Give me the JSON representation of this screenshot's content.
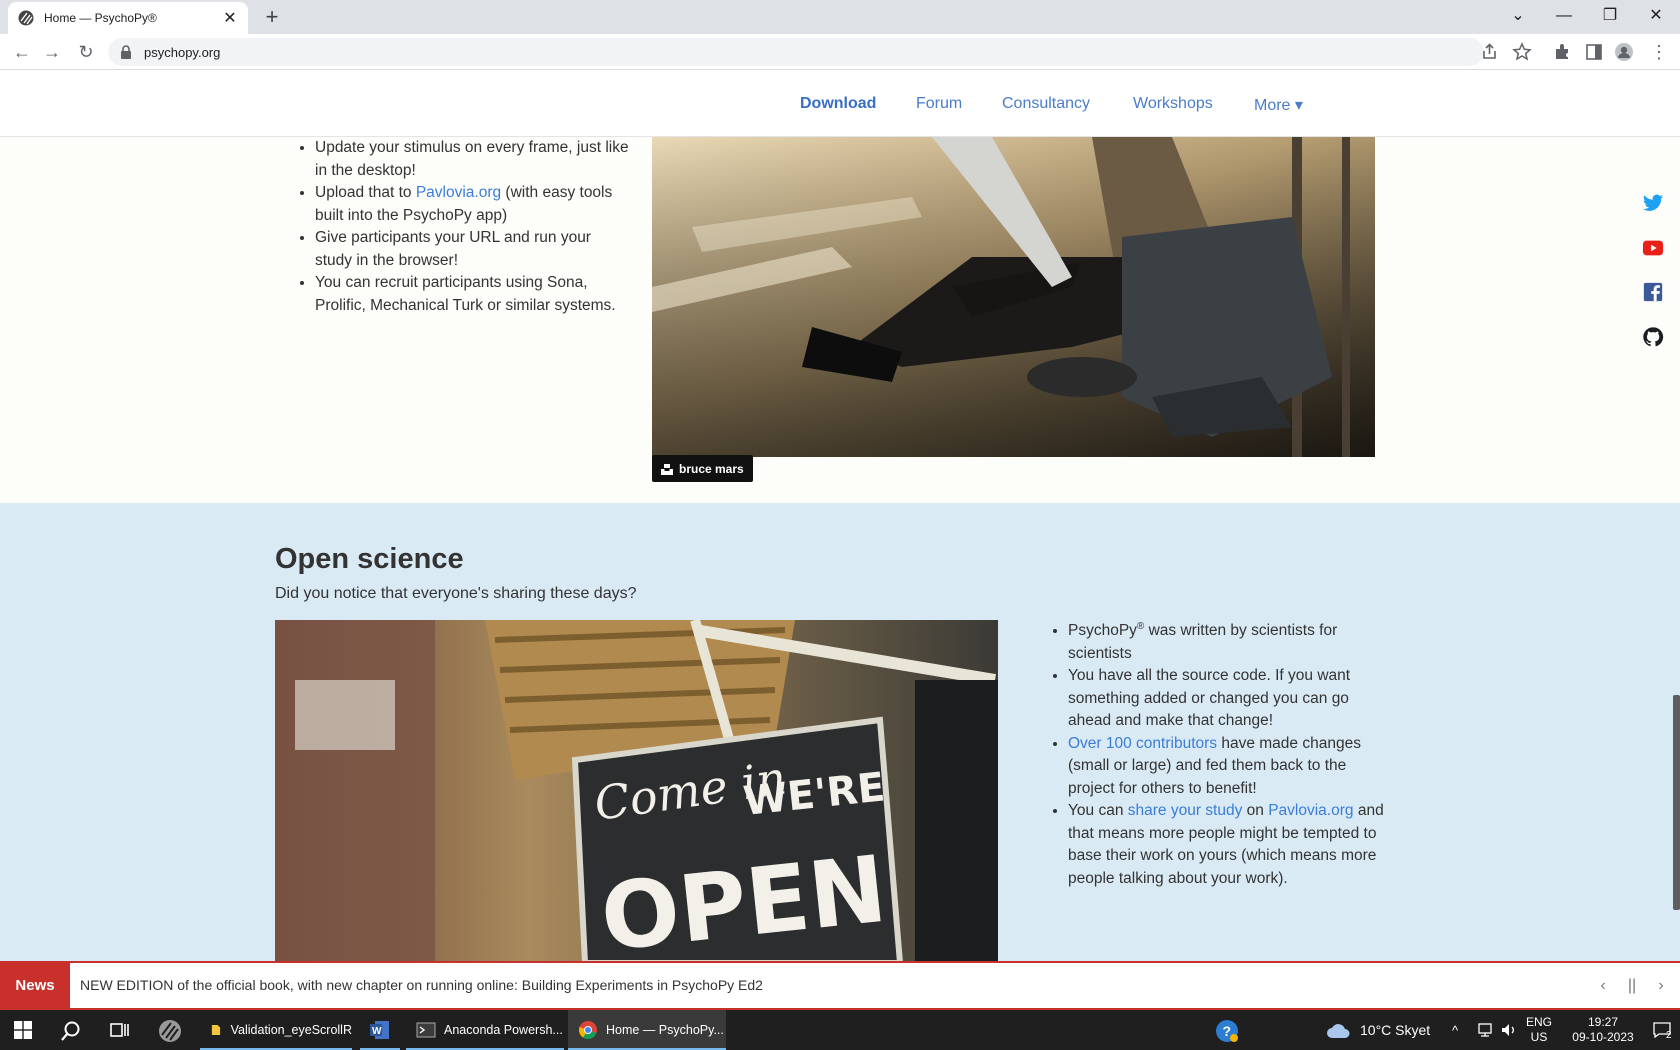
{
  "browser": {
    "tab_title": "Home — PsychoPy®",
    "url": "psychopy.org"
  },
  "nav": {
    "items": [
      {
        "label": "Download"
      },
      {
        "label": "Forum"
      },
      {
        "label": "Consultancy"
      },
      {
        "label": "Workshops"
      },
      {
        "label": "More ▾"
      }
    ]
  },
  "online_section": {
    "b1": "Update your stimulus on every frame, just like in the desktop!",
    "b2_pre": "Upload that to ",
    "b2_link": "Pavlovia.org",
    "b2_post": " (with easy tools built into the PsychoPy app)",
    "b3": "Give participants your URL and run your study in the browser!",
    "b4": "You can recruit participants using Sona, Prolific, Mechanical Turk or similar systems.",
    "photo_credit": "bruce mars"
  },
  "open_science": {
    "heading": "Open science",
    "subtitle": "Did you notice that everyone's sharing these days?",
    "b1_pre": "PsychoPy",
    "b1_sup": "®",
    "b1_post": " was written by scientists for scientists",
    "b2": "You have all the source code. If you want something added or changed you can go ahead and make that change!",
    "b3_link": "Over 100 contributors",
    "b3_post": " have made changes (small or large) and fed them back to the project for others to benefit!",
    "b4_pre": "You can ",
    "b4_link1": "share your study",
    "b4_mid": " on ",
    "b4_link2": "Pavlovia.org",
    "b4_post": " and that means more people might be tempted to base their work on yours (which means more people talking about your work).",
    "sign_text_1": "Come in",
    "sign_text_2": "WE'RE",
    "sign_text_3": "OPEN"
  },
  "news": {
    "label": "News",
    "text": "NEW EDITION of the official book, with new chapter on running online: Building Experiments in PsychoPy Ed2"
  },
  "taskbar": {
    "items": [
      {
        "label": "Validation_eyeScrollR"
      },
      {
        "label": "Anaconda Powersh..."
      },
      {
        "label": "Home — PsychoPy..."
      }
    ],
    "weather": "10°C  Skyet",
    "lang1": "ENG",
    "lang2": "US",
    "time": "19:27",
    "date": "09-10-2023",
    "notif_count": "2"
  },
  "colors": {
    "accent": "#4a7dc9",
    "news_red": "#c9302c",
    "section_bg": "#d9eaf5"
  },
  "icons": [
    "twitter-icon",
    "youtube-icon",
    "facebook-icon",
    "github-icon"
  ]
}
